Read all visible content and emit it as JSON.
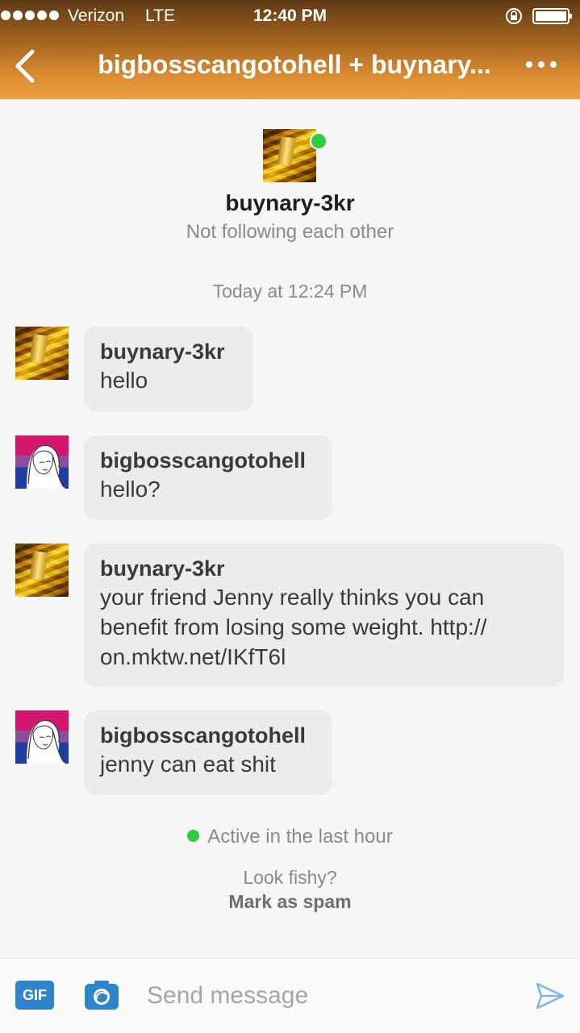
{
  "status_bar": {
    "carrier": "Verizon",
    "network": "LTE",
    "time": "12:40 PM"
  },
  "nav": {
    "title": "bigbosscangotohell + buynary..."
  },
  "profile": {
    "name": "buynary-3kr",
    "relation": "Not following each other",
    "online": true
  },
  "timestamp": "Today at 12:24 PM",
  "messages": [
    {
      "author": "buynary-3kr",
      "text": "hello",
      "avatar": "gold-bars-avatar"
    },
    {
      "author": "bigbosscangotohell",
      "text": "hello?",
      "avatar": "illustrated-woman-avatar"
    },
    {
      "author": "buynary-3kr",
      "text_lines": [
        "your friend Jenny really thinks you can",
        "benefit from losing some weight.  http://",
        "on.mktw.net/IKfT6l"
      ],
      "avatar": "gold-bars-avatar"
    },
    {
      "author": "bigbosscangotohell",
      "text": "jenny can eat shit",
      "avatar": "illustrated-woman-avatar"
    }
  ],
  "activity": "Active in the last hour",
  "spam": {
    "prompt": "Look fishy?",
    "link": "Mark as spam"
  },
  "composer": {
    "gif_label": "GIF",
    "placeholder": "Send message"
  },
  "colors": {
    "header_gradient_top": "#5e3a15",
    "header_gradient_bottom": "#f0a040",
    "online_green": "#2ecc40",
    "gif_blue": "#2f85c9",
    "send_blue": "#7ab7e6",
    "bubble_bg": "#ececec"
  },
  "icons": [
    "back-arrow-icon",
    "more-dots-icon",
    "lock-rotation-icon",
    "battery-icon",
    "camera-icon",
    "send-icon"
  ]
}
